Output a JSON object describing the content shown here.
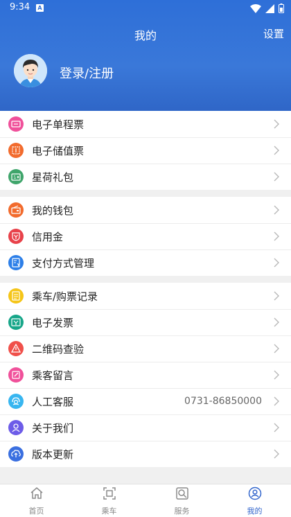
{
  "status_bar": {
    "time": "9:34",
    "a_badge": "A"
  },
  "header": {
    "title": "我的",
    "settings_label": "设置",
    "login_label": "登录/注册"
  },
  "groups": [
    {
      "items": [
        {
          "label": "电子单程票",
          "icon": "single-ticket-icon",
          "color": "#f0509a"
        },
        {
          "label": "电子储值票",
          "icon": "stored-value-ticket-icon",
          "color": "#f26b2d"
        },
        {
          "label": "星荷礼包",
          "icon": "gift-package-icon",
          "color": "#3fa56b"
        }
      ]
    },
    {
      "items": [
        {
          "label": "我的钱包",
          "icon": "wallet-icon",
          "color": "#f26b2d"
        },
        {
          "label": "信用金",
          "icon": "credit-icon",
          "color": "#e8424a"
        },
        {
          "label": "支付方式管理",
          "icon": "payment-method-icon",
          "color": "#2d7fe8"
        }
      ]
    },
    {
      "items": [
        {
          "label": "乘车/购票记录",
          "icon": "ride-record-icon",
          "color": "#f5c518"
        },
        {
          "label": "电子发票",
          "icon": "invoice-icon",
          "color": "#17a689"
        },
        {
          "label": "二维码查验",
          "icon": "qr-check-icon",
          "color": "#f0504a"
        },
        {
          "label": "乘客留言",
          "icon": "message-icon",
          "color": "#f0509a"
        },
        {
          "label": "人工客服",
          "icon": "customer-service-icon",
          "color": "#38b6f0",
          "value": "0731-86850000"
        },
        {
          "label": "关于我们",
          "icon": "about-icon",
          "color": "#6d5ce8"
        },
        {
          "label": "版本更新",
          "icon": "update-icon",
          "color": "#3a6fe0"
        }
      ]
    }
  ],
  "tabbar": [
    {
      "label": "首页",
      "icon": "home-icon",
      "active": false
    },
    {
      "label": "乘车",
      "icon": "ride-qr-icon",
      "active": false
    },
    {
      "label": "服务",
      "icon": "service-icon",
      "active": false
    },
    {
      "label": "我的",
      "icon": "profile-icon",
      "active": true
    }
  ],
  "colors": {
    "header": "#2e6fd8",
    "accent": "#3366cc"
  }
}
